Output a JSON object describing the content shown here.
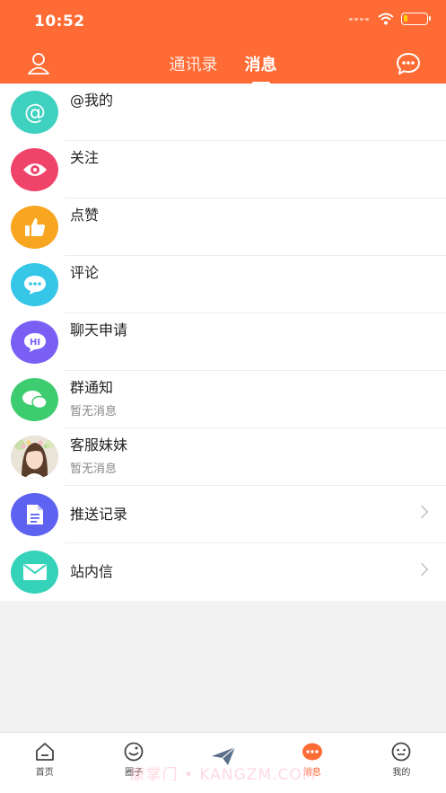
{
  "status_bar": {
    "time": "10:52"
  },
  "header": {
    "tabs": [
      {
        "label": "通讯录",
        "active": false
      },
      {
        "label": "消息",
        "active": true
      }
    ],
    "accent": "#ff6b35"
  },
  "messages": [
    {
      "title": "@我的",
      "subtitle": "",
      "icon": "at-icon",
      "color": "#3fd1c0"
    },
    {
      "title": "关注",
      "subtitle": "",
      "icon": "eye-icon",
      "color": "#f0436a"
    },
    {
      "title": "点赞",
      "subtitle": "",
      "icon": "thumbs-up-icon",
      "color": "#f8a51f"
    },
    {
      "title": "评论",
      "subtitle": "",
      "icon": "comment-bubble-icon",
      "color": "#35c6e8"
    },
    {
      "title": "聊天申请",
      "subtitle": "",
      "icon": "hi-bubble-icon",
      "color": "#7a5ff5"
    },
    {
      "title": "群通知",
      "subtitle": "暂无消息",
      "icon": "group-chat-icon",
      "color": "#3dcc6f"
    },
    {
      "title": "客服妹妹",
      "subtitle": "暂无消息",
      "icon": "support-avatar",
      "color": "#e7e0d6"
    },
    {
      "title": "推送记录",
      "subtitle": "",
      "icon": "document-icon",
      "color": "#5e62f0"
    },
    {
      "title": "站内信",
      "subtitle": "",
      "icon": "envelope-icon",
      "color": "#34d2b8"
    }
  ],
  "tabbar": {
    "items": [
      {
        "label": "首页",
        "icon": "home-icon"
      },
      {
        "label": "圈子",
        "icon": "circle-icon"
      },
      {
        "label": "",
        "icon": "paper-plane-icon"
      },
      {
        "label": "消息",
        "icon": "message-icon",
        "active": true
      },
      {
        "label": "我的",
        "icon": "profile-icon"
      }
    ]
  },
  "watermark": "康掌门 • KANGZM.COM"
}
